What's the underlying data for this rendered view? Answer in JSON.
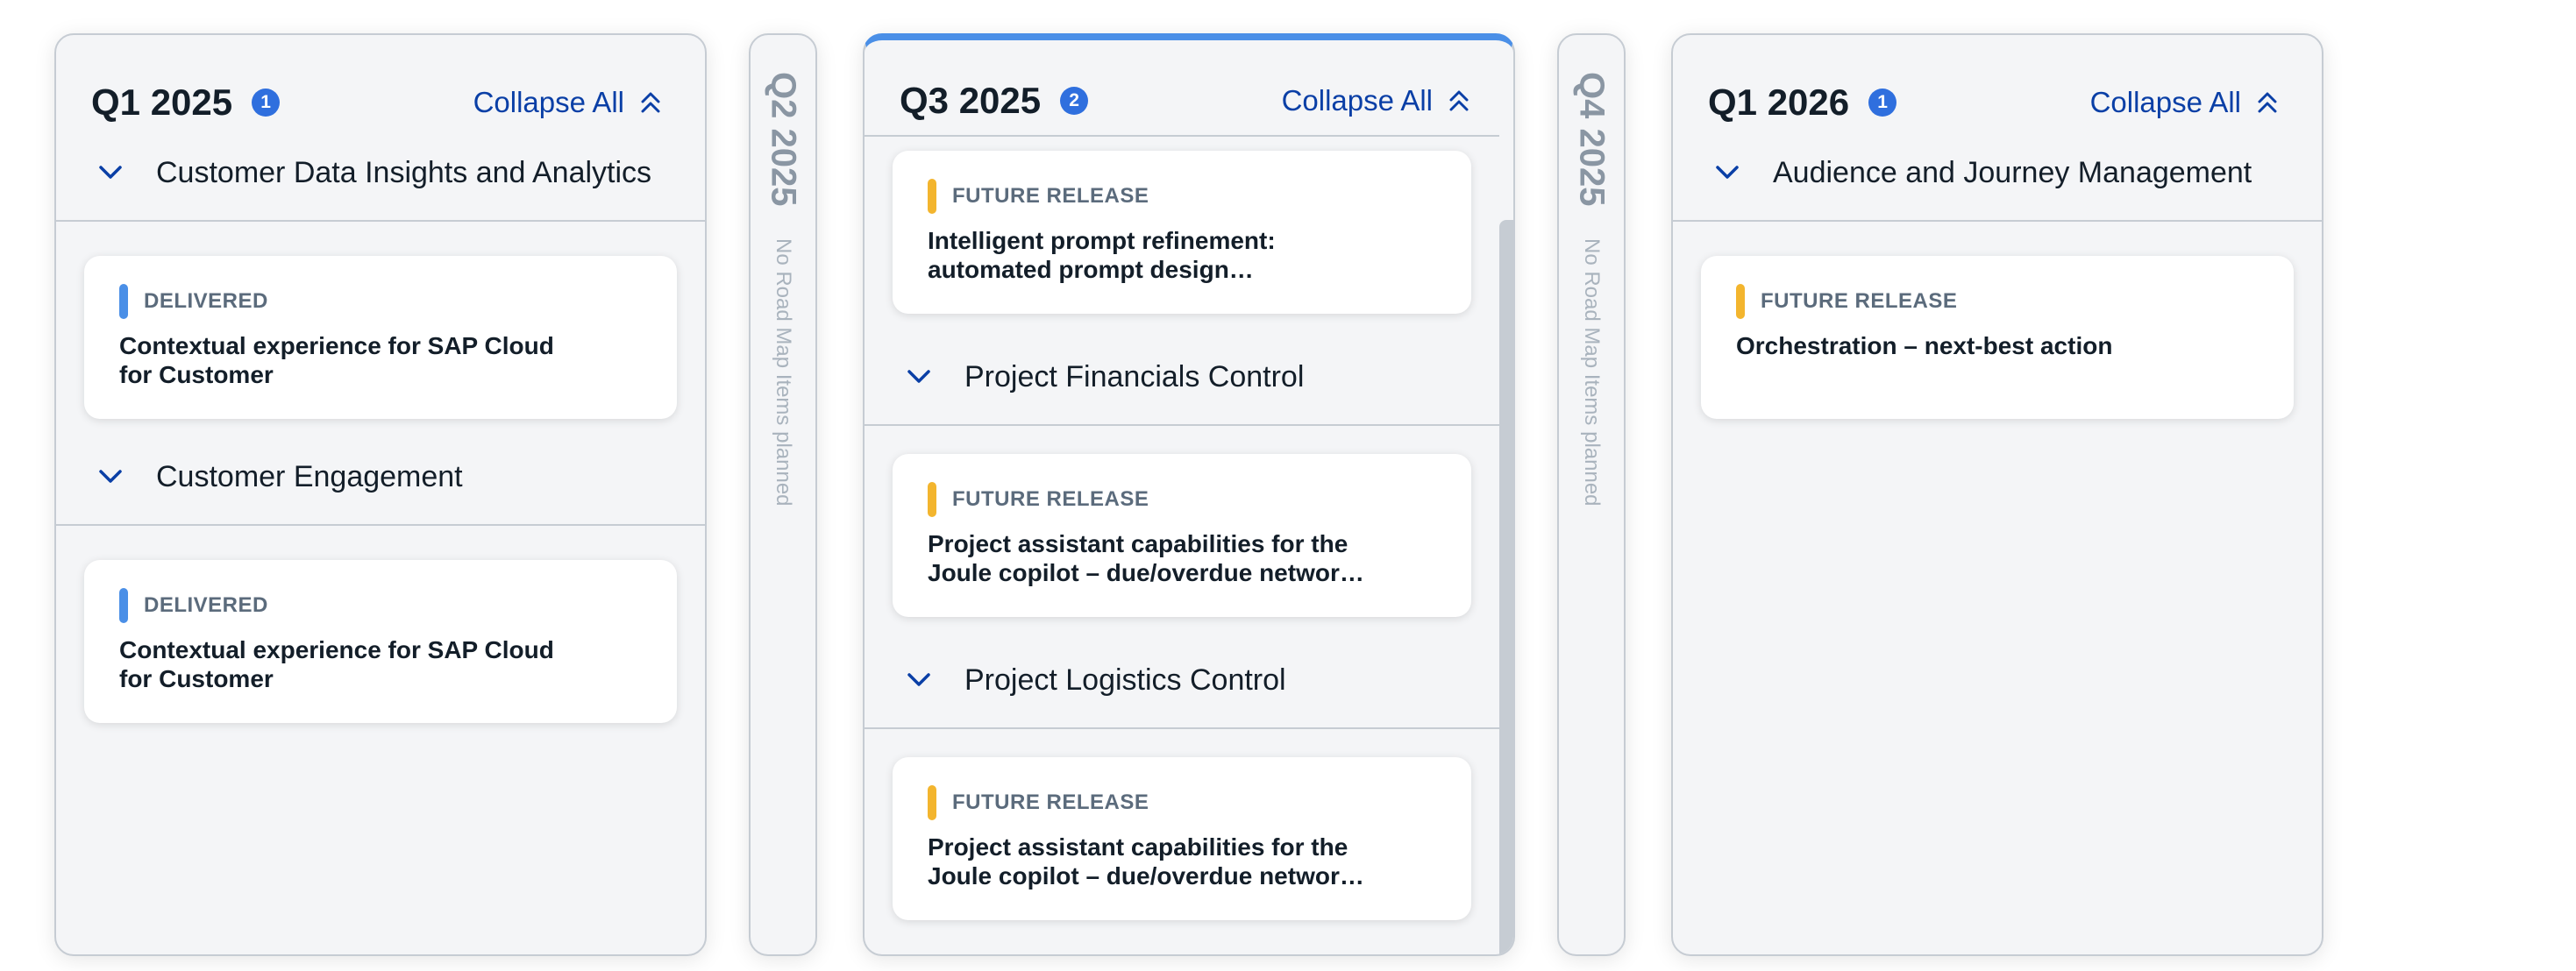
{
  "columns": [
    {
      "quarter": "Q1 2025",
      "badge": "1",
      "collapse_label": "Collapse All",
      "groups": [
        {
          "title": "Customer Data Insights and Analytics",
          "items": [
            {
              "status": "DELIVERED",
              "title": "Contextual experience for SAP Cloud for Customer"
            }
          ]
        },
        {
          "title": "Customer Engagement",
          "items": [
            {
              "status": "DELIVERED",
              "title": "Contextual experience for SAP Cloud for Customer"
            }
          ]
        }
      ]
    },
    {
      "quarter": "Q2 2025",
      "note": "No Road Map Items planned"
    },
    {
      "quarter": "Q3 2025",
      "badge": "2",
      "collapse_label": "Collapse All",
      "top_item": {
        "status": "FUTURE RELEASE",
        "title": "Intelligent prompt refinement: automated prompt design…"
      },
      "groups": [
        {
          "title": "Project Financials Control",
          "items": [
            {
              "status": "FUTURE RELEASE",
              "title": "Project assistant capabilities for the Joule copilot – due/overdue networ…"
            }
          ]
        },
        {
          "title": "Project Logistics Control",
          "items": [
            {
              "status": "FUTURE RELEASE",
              "title": "Project assistant capabilities for the Joule copilot – due/overdue networ…"
            }
          ]
        }
      ]
    },
    {
      "quarter": "Q4 2025",
      "note": "No Road Map Items planned"
    },
    {
      "quarter": "Q1 2026",
      "badge": "1",
      "collapse_label": "Collapse All",
      "groups": [
        {
          "title": "Audience and Journey Management",
          "items": [
            {
              "status": "FUTURE RELEASE",
              "title": "Orchestration – next-best action"
            }
          ]
        }
      ]
    }
  ],
  "colors": {
    "delivered": "#4a8fe7",
    "future_release": "#f3b52e",
    "badge": "#2f6fde",
    "link": "#0a3fa6"
  },
  "icons": {
    "collapse": "double-chevron-up-icon",
    "group_toggle": "chevron-down-icon"
  }
}
